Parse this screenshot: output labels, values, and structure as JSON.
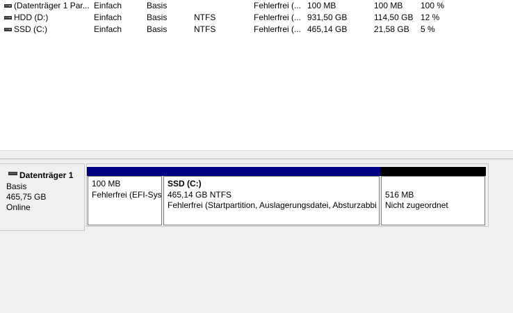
{
  "volumes": [
    {
      "name": "(Datenträger 1 Par...",
      "layout": "Einfach",
      "type": "Basis",
      "filesystem": "",
      "status": "Fehlerfrei (...",
      "capacity": "100 MB",
      "free": "100 MB",
      "percent_free": "100 %"
    },
    {
      "name": "HDD (D:)",
      "layout": "Einfach",
      "type": "Basis",
      "filesystem": "NTFS",
      "status": "Fehlerfrei (...",
      "capacity": "931,50 GB",
      "free": "114,50 GB",
      "percent_free": "12 %"
    },
    {
      "name": "SSD (C:)",
      "layout": "Einfach",
      "type": "Basis",
      "filesystem": "NTFS",
      "status": "Fehlerfrei (...",
      "capacity": "465,14 GB",
      "free": "21,58 GB",
      "percent_free": "5 %"
    }
  ],
  "disk": {
    "name": "Datenträger 1",
    "type": "Basis",
    "size": "465,75 GB",
    "state": "Online",
    "partitions": [
      {
        "title": "",
        "size": "100 MB",
        "status": "Fehlerfrei (EFI-Sys",
        "color": "#000080"
      },
      {
        "title": "SSD  (C:)",
        "size": "465,14 GB NTFS",
        "status": "Fehlerfrei (Startpartition, Auslagerungsdatei, Absturzabbi",
        "color": "#000080"
      },
      {
        "title": "",
        "size": "516 MB",
        "status": "Nicht zugeordnet",
        "color": "#000000"
      }
    ]
  },
  "colors": {
    "primary_partition": "#000080",
    "unallocated": "#000000",
    "pane_background": "#f0f0f0"
  },
  "icons": {
    "volume": "drive-icon",
    "disk": "disk-icon"
  }
}
